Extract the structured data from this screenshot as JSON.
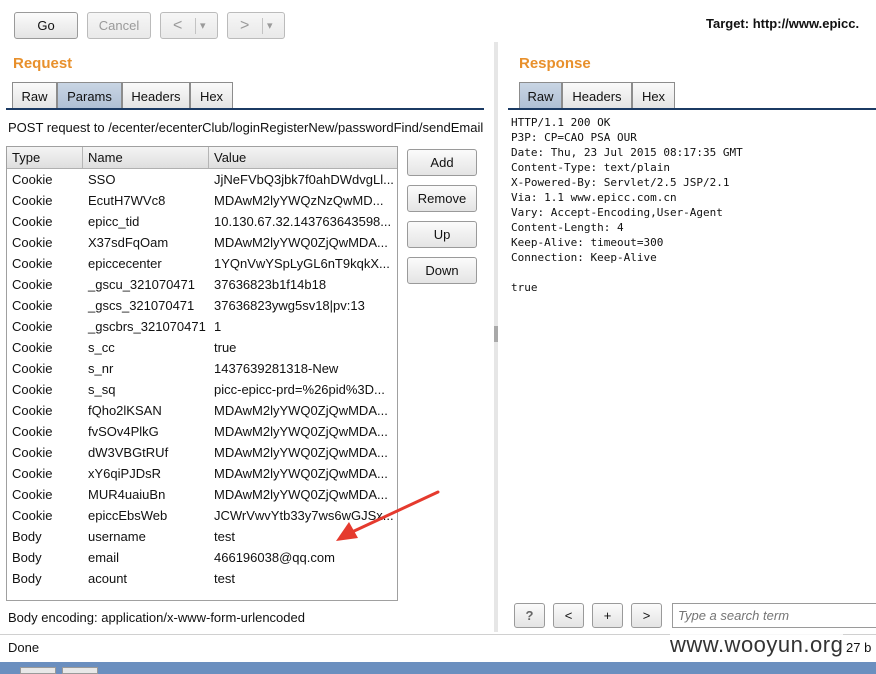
{
  "toolbar": {
    "go": "Go",
    "cancel": "Cancel",
    "back": "<",
    "back_menu": "▾",
    "forward": ">",
    "forward_menu": "▾",
    "target": "Target: http://www.epicc."
  },
  "request": {
    "title": "Request",
    "tabs": [
      "Raw",
      "Params",
      "Headers",
      "Hex"
    ],
    "active_tab": "Params",
    "summary": "POST request to /ecenter/ecenterClub/loginRegisterNew/passwordFind/sendEmail",
    "columns": [
      "Type",
      "Name",
      "Value"
    ],
    "rows": [
      {
        "type": "Cookie",
        "name": "SSO",
        "value": "JjNeFVbQ3jbk7f0ahDWdvgLl..."
      },
      {
        "type": "Cookie",
        "name": "EcutH7WVc8",
        "value": "MDAwM2lyYWQzNzQwMD..."
      },
      {
        "type": "Cookie",
        "name": "epicc_tid",
        "value": "10.130.67.32.143763643598..."
      },
      {
        "type": "Cookie",
        "name": "X37sdFqOam",
        "value": "MDAwM2lyYWQ0ZjQwMDA..."
      },
      {
        "type": "Cookie",
        "name": "epiccecenter",
        "value": "1YQnVwYSpLyGL6nT9kqkX..."
      },
      {
        "type": "Cookie",
        "name": "_gscu_321070471",
        "value": "37636823b1f14b18"
      },
      {
        "type": "Cookie",
        "name": "_gscs_321070471",
        "value": "37636823ywg5sv18|pv:13"
      },
      {
        "type": "Cookie",
        "name": "_gscbrs_321070471",
        "value": "1"
      },
      {
        "type": "Cookie",
        "name": "s_cc",
        "value": "true"
      },
      {
        "type": "Cookie",
        "name": "s_nr",
        "value": "1437639281318-New"
      },
      {
        "type": "Cookie",
        "name": "s_sq",
        "value": "picc-epicc-prd=%26pid%3D..."
      },
      {
        "type": "Cookie",
        "name": "fQho2lKSAN",
        "value": "MDAwM2lyYWQ0ZjQwMDA..."
      },
      {
        "type": "Cookie",
        "name": "fvSOv4PlkG",
        "value": "MDAwM2lyYWQ0ZjQwMDA..."
      },
      {
        "type": "Cookie",
        "name": "dW3VBGtRUf",
        "value": "MDAwM2lyYWQ0ZjQwMDA..."
      },
      {
        "type": "Cookie",
        "name": "xY6qiPJDsR",
        "value": "MDAwM2lyYWQ0ZjQwMDA..."
      },
      {
        "type": "Cookie",
        "name": "MUR4uaiuBn",
        "value": "MDAwM2lyYWQ0ZjQwMDA..."
      },
      {
        "type": "Cookie",
        "name": "epiccEbsWeb",
        "value": "JCWrVwvYtb33y7ws6wGJSx..."
      },
      {
        "type": "Body",
        "name": "username",
        "value": "test"
      },
      {
        "type": "Body",
        "name": "email",
        "value": "466196038@qq.com"
      },
      {
        "type": "Body",
        "name": "acount",
        "value": "test"
      }
    ],
    "buttons": {
      "add": "Add",
      "remove": "Remove",
      "up": "Up",
      "down": "Down"
    },
    "body_encoding": "Body encoding: application/x-www-form-urlencoded"
  },
  "response": {
    "title": "Response",
    "tabs": [
      "Raw",
      "Headers",
      "Hex"
    ],
    "active_tab": "Raw",
    "raw": "HTTP/1.1 200 OK\nP3P: CP=CAO PSA OUR\nDate: Thu, 23 Jul 2015 08:17:35 GMT\nContent-Type: text/plain\nX-Powered-By: Servlet/2.5 JSP/2.1\nVia: 1.1 www.epicc.com.cn\nVary: Accept-Encoding,User-Agent\nContent-Length: 4\nKeep-Alive: timeout=300\nConnection: Keep-Alive\n\ntrue",
    "search": {
      "help": "?",
      "prev": "<",
      "add": "+",
      "next": ">",
      "placeholder": "Type a search term"
    }
  },
  "status": {
    "text": "Done",
    "right": "27 b"
  },
  "watermark": "www.wooyun.org",
  "colors": {
    "section_title": "#e8902c",
    "tab_active": "#b4c4d8",
    "tab_underline": "#1b3a63",
    "annotation_arrow": "#e53a2e"
  }
}
